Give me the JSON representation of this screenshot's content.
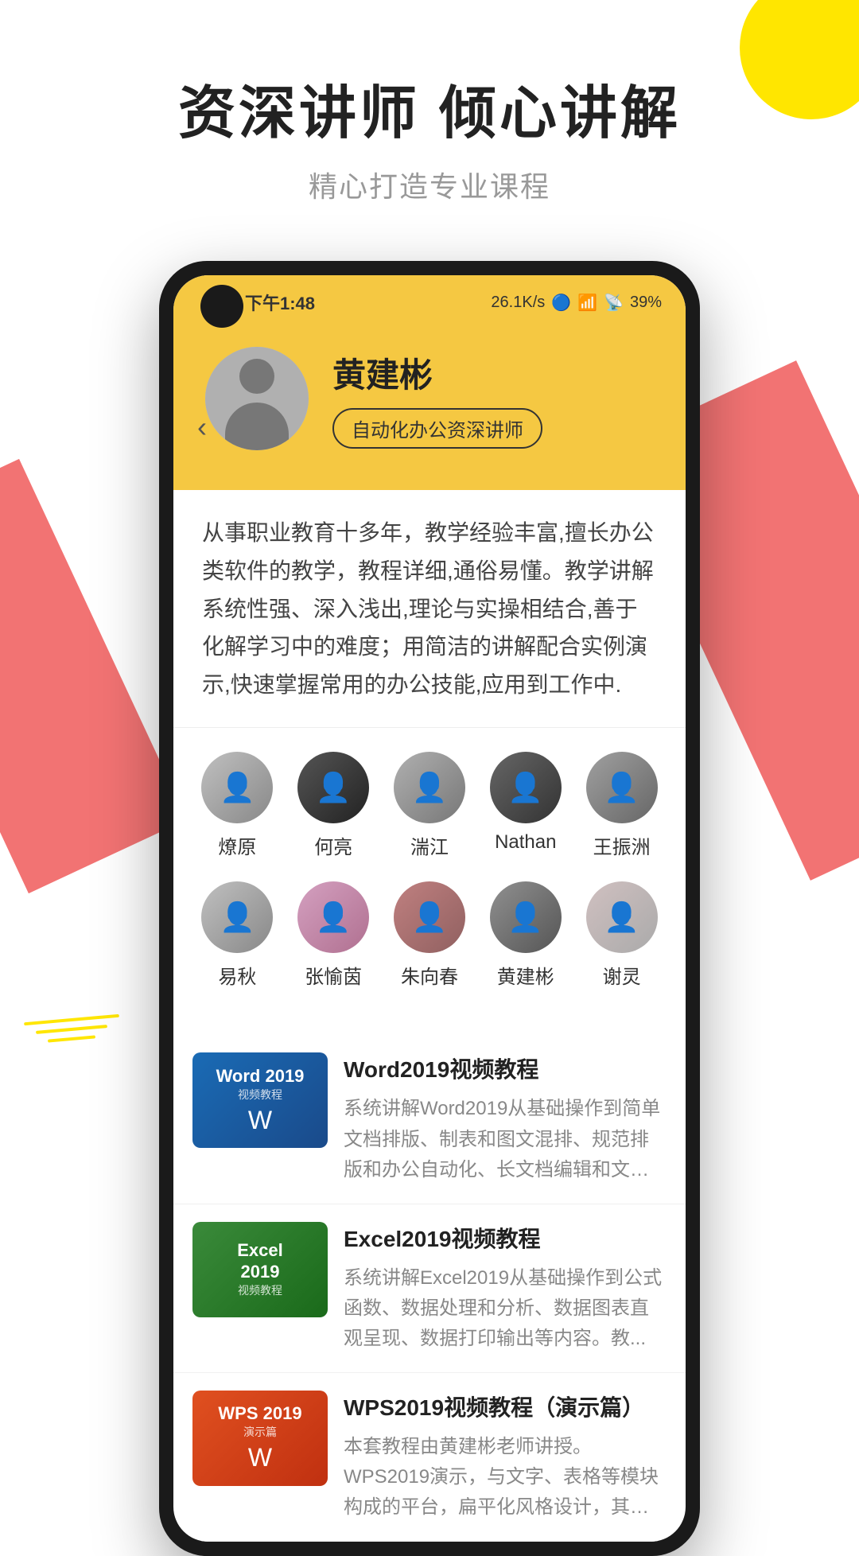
{
  "app": {
    "hero_title": "资深讲师  倾心讲解",
    "hero_subtitle": "精心打造专业课程"
  },
  "phone": {
    "status_time": "下午1:48",
    "status_network": "26.1K/s",
    "status_battery": "39%"
  },
  "instructor": {
    "name": "黄建彬",
    "tag": "自动化办公资深讲师",
    "description": "从事职业教育十多年，教学经验丰富,擅长办公类软件的教学，教程详细,通俗易懂。教学讲解系统性强、深入浅出,理论与实操相结合,善于化解学习中的难度；用简洁的讲解配合实例演示,快速掌握常用的办公技能,应用到工作中."
  },
  "instructors_row1": [
    {
      "name": "燎原",
      "face_class": "face-1"
    },
    {
      "name": "何亮",
      "face_class": "face-2"
    },
    {
      "name": "湍江",
      "face_class": "face-3"
    },
    {
      "name": "Nathan",
      "face_class": "face-4"
    },
    {
      "name": "王振洲",
      "face_class": "face-5"
    }
  ],
  "instructors_row2": [
    {
      "name": "易秋",
      "face_class": "face-6"
    },
    {
      "name": "张愉茵",
      "face_class": "face-7"
    },
    {
      "name": "朱向春",
      "face_class": "face-8"
    },
    {
      "name": "黄建彬",
      "face_class": "face-9"
    },
    {
      "name": "谢灵",
      "face_class": "face-10"
    }
  ],
  "courses": [
    {
      "id": "word2019",
      "title": "Word2019视频教程",
      "description": "系统讲解Word2019从基础操作到简单文档排版、制表和图文混排、规范排版和办公自动化、长文档编辑和文档安...",
      "thumb_type": "word",
      "thumb_label1": "Word 2019",
      "thumb_label2": "视频教程"
    },
    {
      "id": "excel2019",
      "title": "Excel2019视频教程",
      "description": "系统讲解Excel2019从基础操作到公式函数、数据处理和分析、数据图表直观呈现、数据打印输出等内容。教...",
      "thumb_type": "excel",
      "thumb_label1": "Excel",
      "thumb_label2": "2019",
      "thumb_label3": "视频教程"
    },
    {
      "id": "wps2019",
      "title": "WPS2019视频教程（演示篇）",
      "description": "本套教程由黄建彬老师讲授。WPS2019演示，与文字、表格等模块构成的平台，扁平化风格设计，其一键...",
      "thumb_type": "wps",
      "thumb_label1": "WPS 2019",
      "thumb_label2": "演示篇"
    }
  ]
}
